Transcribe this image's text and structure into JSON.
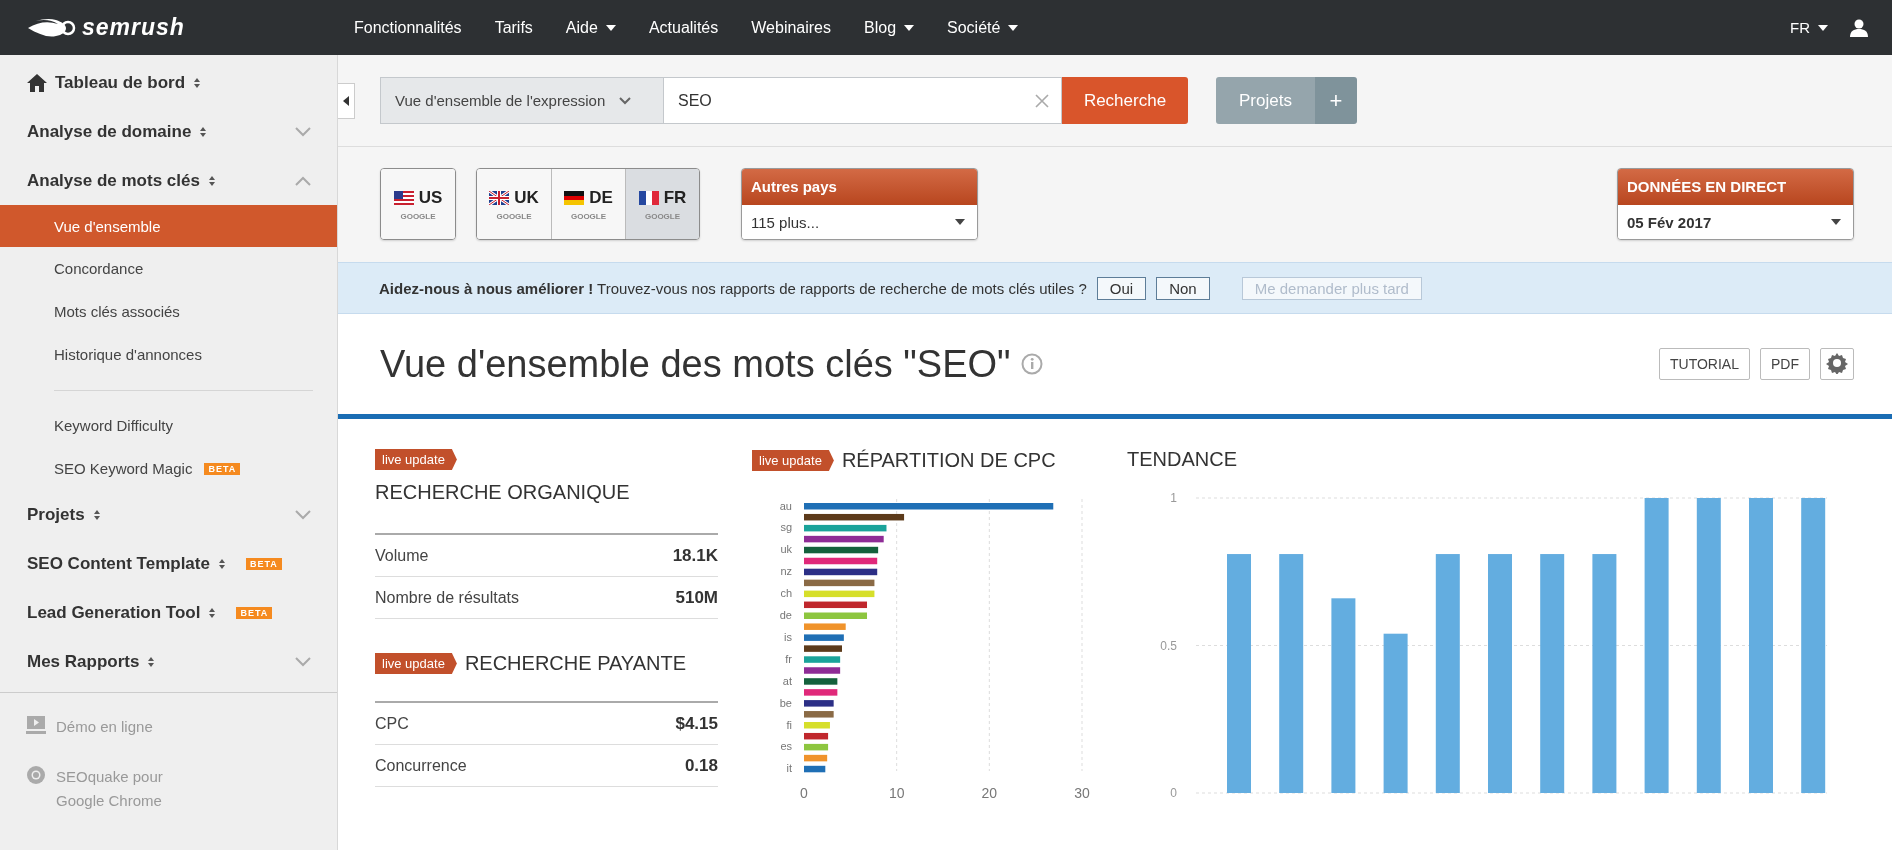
{
  "nav": {
    "logo": "semrush",
    "menu": [
      {
        "label": "Fonctionnalités",
        "dropdown": false
      },
      {
        "label": "Tarifs",
        "dropdown": false
      },
      {
        "label": "Aide",
        "dropdown": true
      },
      {
        "label": "Actualités",
        "dropdown": false
      },
      {
        "label": "Webinaires",
        "dropdown": false
      },
      {
        "label": "Blog",
        "dropdown": true
      },
      {
        "label": "Société",
        "dropdown": true
      }
    ],
    "language": "FR"
  },
  "sidebar": {
    "items": [
      {
        "label": "Tableau de bord",
        "kind": "home"
      },
      {
        "label": "Analyse de domaine",
        "kind": "group",
        "expanded": false
      },
      {
        "label": "Analyse de mots clés",
        "kind": "group",
        "expanded": true,
        "children": [
          {
            "label": "Vue d'ensemble",
            "selected": true,
            "divider_before": false
          },
          {
            "label": "Concordance",
            "selected": false,
            "divider_before": false
          },
          {
            "label": "Mots clés associés",
            "selected": false,
            "divider_before": false
          },
          {
            "label": "Historique d'annonces",
            "selected": false,
            "divider_before": false
          },
          {
            "label": "Keyword Difficulty",
            "selected": false,
            "divider_before": true
          },
          {
            "label": "SEO Keyword Magic",
            "selected": false,
            "divider_before": false,
            "badge": "BETA"
          }
        ]
      },
      {
        "label": "Projets",
        "kind": "group",
        "expanded": false
      },
      {
        "label": "SEO Content Template",
        "kind": "section",
        "badge": "BETA"
      },
      {
        "label": "Lead Generation Tool",
        "kind": "section",
        "badge": "BETA"
      },
      {
        "label": "Mes Rapports",
        "kind": "group",
        "expanded": false
      }
    ],
    "footer": [
      {
        "label": "Démo en ligne",
        "kind": "demo"
      },
      {
        "label": "SEOquake pour Google Chrome",
        "kind": "extension"
      }
    ]
  },
  "search": {
    "mode": "Vue d'ensemble de l'expression",
    "value": "SEO",
    "button": "Recherche",
    "projects": "Projets",
    "add": "+"
  },
  "databases": {
    "groups": [
      {
        "items": [
          {
            "code": "US",
            "engine": "GOOGLE",
            "selected": false
          }
        ]
      },
      {
        "items": [
          {
            "code": "UK",
            "engine": "GOOGLE",
            "selected": false
          },
          {
            "code": "DE",
            "engine": "GOOGLE",
            "selected": false
          },
          {
            "code": "FR",
            "engine": "GOOGLE",
            "selected": true
          }
        ]
      }
    ],
    "other": {
      "label": "Autres pays",
      "value": "115 plus..."
    },
    "date": {
      "label": "DONNÉES EN DIRECT",
      "value": "05 Fév 2017"
    }
  },
  "banner": {
    "text": "**Aidez-nous à nous améliorer !** Trouvez-vous nos rapports de rapports de recherche de mots clés utiles ?",
    "buttons": [
      {
        "label": "Oui",
        "disabled": false
      },
      {
        "label": "Non",
        "disabled": false
      },
      {
        "label": "Me demander plus tard",
        "disabled": true
      }
    ]
  },
  "report": {
    "title": "Vue d'ensemble des mots clés \"SEO\"",
    "buttons": [
      "TUTORIAL",
      "PDF"
    ],
    "panels": [
      {
        "badge": "live update",
        "title": "RECHERCHE ORGANIQUE",
        "kind": "stacked",
        "rows": [
          {
            "label": "Volume",
            "value": "18.1K"
          },
          {
            "label": "Nombre de résultats",
            "value": "510M"
          }
        ]
      },
      {
        "badge": "live update",
        "title": "RECHERCHE PAYANTE",
        "kind": "inline",
        "rows": [
          {
            "label": "CPC",
            "value": "$4.15"
          },
          {
            "label": "Concurrence",
            "value": "0.18"
          }
        ]
      }
    ],
    "cpc": {
      "badge": "live update",
      "title": "RÉPARTITION DE CPC",
      "chart_data": {
        "type": "bar",
        "orientation": "horizontal",
        "categories": [
          "au",
          null,
          "sg",
          null,
          "uk",
          null,
          "nz",
          null,
          "ch",
          null,
          "de",
          null,
          "is",
          null,
          "fr",
          null,
          "at",
          null,
          "be",
          null,
          "fi",
          null,
          "es",
          null,
          "it"
        ],
        "values": [
          26.9,
          10.8,
          8.9,
          8.6,
          8.0,
          7.9,
          7.9,
          7.6,
          7.6,
          6.8,
          6.8,
          4.5,
          4.3,
          4.1,
          3.9,
          3.9,
          3.6,
          3.6,
          3.2,
          3.2,
          2.8,
          2.6,
          2.6,
          2.5,
          2.3
        ],
        "colors": [
          "#1f6fb5",
          "#5c3a1a",
          "#1aa39a",
          "#8e2c96",
          "#14613c",
          "#e0297a",
          "#2c2f86",
          "#8a6a45",
          "#d6df2a",
          "#c0272d",
          "#8dc63f",
          "#f0932b",
          "#1f6fb5",
          "#5c3a1a",
          "#1aa39a",
          "#8e2c96",
          "#14613c",
          "#e0297a",
          "#2c2f86",
          "#8a6a45",
          "#d6df2a",
          "#c0272d",
          "#8dc63f",
          "#f0932b",
          "#1f6fb5"
        ],
        "xlim": [
          0,
          30
        ],
        "xticks": [
          0,
          10,
          20,
          30
        ]
      }
    },
    "trend": {
      "title": "TENDANCE",
      "chart_data": {
        "type": "bar",
        "values": [
          0.81,
          0.81,
          0.66,
          0.54,
          0.81,
          0.81,
          0.81,
          0.81,
          1,
          1,
          1,
          1
        ],
        "ylim": [
          0,
          1
        ],
        "yticks": [
          0,
          0.5,
          1
        ]
      }
    }
  }
}
